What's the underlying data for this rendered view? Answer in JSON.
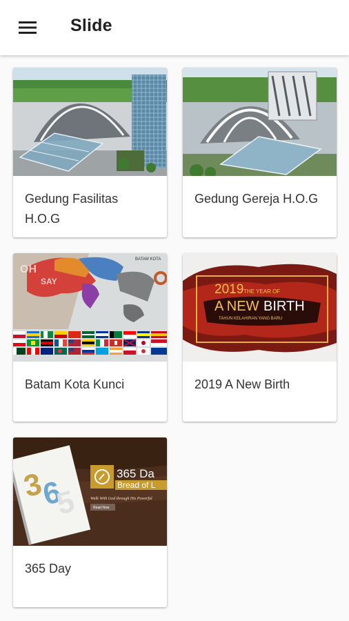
{
  "app_bar": {
    "title": "Slide",
    "menu_icon": "hamburger-menu-icon"
  },
  "cards": [
    {
      "title": "Gedung Fasilitas H.O.G",
      "thumbnail": "arena-building-rendering"
    },
    {
      "title": "Gedung Gereja H.O.G",
      "thumbnail": "church-building-rendering"
    },
    {
      "title": "Batam Kota Kunci",
      "thumbnail": "world-map-with-flags",
      "thumb_text": "BATAM KOTA"
    },
    {
      "title": "2019 A New Birth",
      "thumbnail": "new-birth-banner",
      "thumb_text": {
        "year": "2019",
        "subtitle": "THE YEAR OF",
        "headline_1": "A NEW",
        "headline_2": "BIRTH",
        "tagline": "TAHUN KELAHIRAN YANG BARU"
      }
    },
    {
      "title": "365 Day",
      "thumbnail": "bread-of-life-book",
      "thumb_text": {
        "heading": "365 Da",
        "subheading": "Bread of L",
        "line": "Walk With God through His Powerful",
        "button": "Read Now"
      }
    }
  ],
  "colors": {
    "appbar": "#ffffff",
    "background": "#fafafa",
    "text": "#212121",
    "accent_gold": "#e8b040"
  }
}
